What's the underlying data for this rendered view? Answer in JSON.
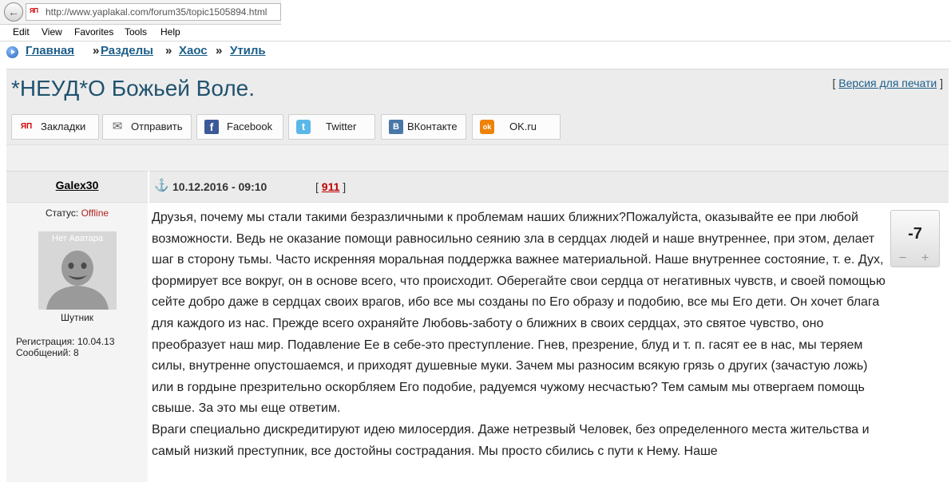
{
  "browser": {
    "back_icon": "back-arrow-icon",
    "favicon_text": "ЯП",
    "url": "http://www.yaplakal.com/forum35/topic1505894.html",
    "menu": [
      "Edit",
      "View",
      "Favorites",
      "Tools",
      "Help"
    ]
  },
  "breadcrumb": {
    "items": [
      "Главная",
      "Разделы",
      "Хаос",
      "Утиль"
    ],
    "separator": "»"
  },
  "topic": {
    "title": "*НЕУД*О Божьей Воле.",
    "print_open": "[",
    "print_link": "Версия для печати",
    "print_close": "]"
  },
  "share": {
    "buttons": [
      {
        "icon": "ЯП",
        "label": "Закладки"
      },
      {
        "icon": "✉",
        "label": "Отправить"
      },
      {
        "icon": "f",
        "label": "Facebook"
      },
      {
        "icon": "t",
        "label": "Twitter"
      },
      {
        "icon": "B",
        "label": "ВКонтакте"
      },
      {
        "icon": "ok",
        "label": "OK.ru"
      }
    ]
  },
  "post": {
    "author": "Galex30",
    "status_label": "Статус:",
    "status_value": "Offline",
    "avatar_caption": "Нет Аватара",
    "rank": "Шутник",
    "registration": "Регистрация: 10.04.13",
    "messages": "Сообщений: 8",
    "anchor_icon": "⚓",
    "date": "10.12.2016 - 09:10",
    "num_open": "[",
    "num": "911",
    "num_close": "]",
    "rating": "-7",
    "vote_minus": "−",
    "vote_plus": "+",
    "paragraphs": [
      "Друзья, почему мы стали такими безразличными к проблемам наших ближних?Пожалуйста, оказывайте ее при любой возможности. Ведь не оказание помощи равносильно сеянию зла в сердцах людей и наше внутреннее, при этом, делает шаг в сторону тьмы. Часто искренняя моральная поддержка важнее материальной. Наше внутреннее состояние, т. е. Дух, формирует все вокруг, он в основе всего, что происходит. Оберегайте свои сердца от негативных чувств, и своей помощью сейте добро даже в сердцах своих врагов, ибо все мы созданы по Его образу и подобию, все мы Его дети. Он хочет блага для каждого из нас. Прежде всего охраняйте Любовь-заботу о ближних в своих сердцах, это святое чувство, оно преобразует наш мир. Подавление Ее в себе-это преступление. Гнев, презрение, блуд и т. п. гасят ее в нас, мы теряем силы, внутренне опустошаемся, и приходят душевные муки. Зачем мы разносим всякую грязь о других (зачастую ложь) или в гордыне презрительно оскорбляем Его подобие, радуемся чужому несчастью? Тем самым мы отвергаем помощь свыше. За это мы еще ответим.",
      "Враги специально дискредитируют идею милосердия. Даже нетрезвый Человек, без определенного места жительства и самый низкий преступник, все достойны сострадания. Мы просто сбились с пути к Нему. Наше"
    ]
  }
}
